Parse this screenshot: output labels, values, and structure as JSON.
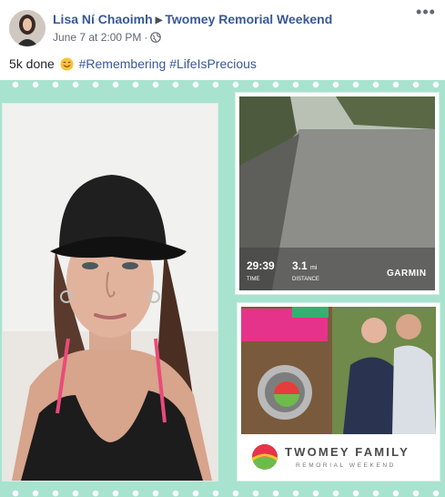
{
  "post": {
    "author": "Lisa Ní Chaoimh",
    "page": "Twomey Remorial Weekend",
    "timestamp": "June 7 at 2:00 PM",
    "privacy_icon": "globe-icon",
    "more_options": "•••",
    "text_plain": "5k done",
    "emoji": "smiling-face-emoji",
    "hashtags": [
      "#Remembering",
      "#LifeIsPrecious"
    ]
  },
  "collage": {
    "background_color": "#a8e3cf",
    "run_stats": {
      "time_value": "29:39",
      "time_label": "TIME",
      "distance_value": "3.1",
      "distance_unit": "mi",
      "distance_label": "DISTANCE",
      "brand": "GARMIN"
    },
    "logo": {
      "title": "TWOMEY FAMILY",
      "subtitle": "REMORIAL WEEKEND"
    }
  },
  "colors": {
    "link": "#385898",
    "text": "#1d2129",
    "meta": "#616770"
  }
}
